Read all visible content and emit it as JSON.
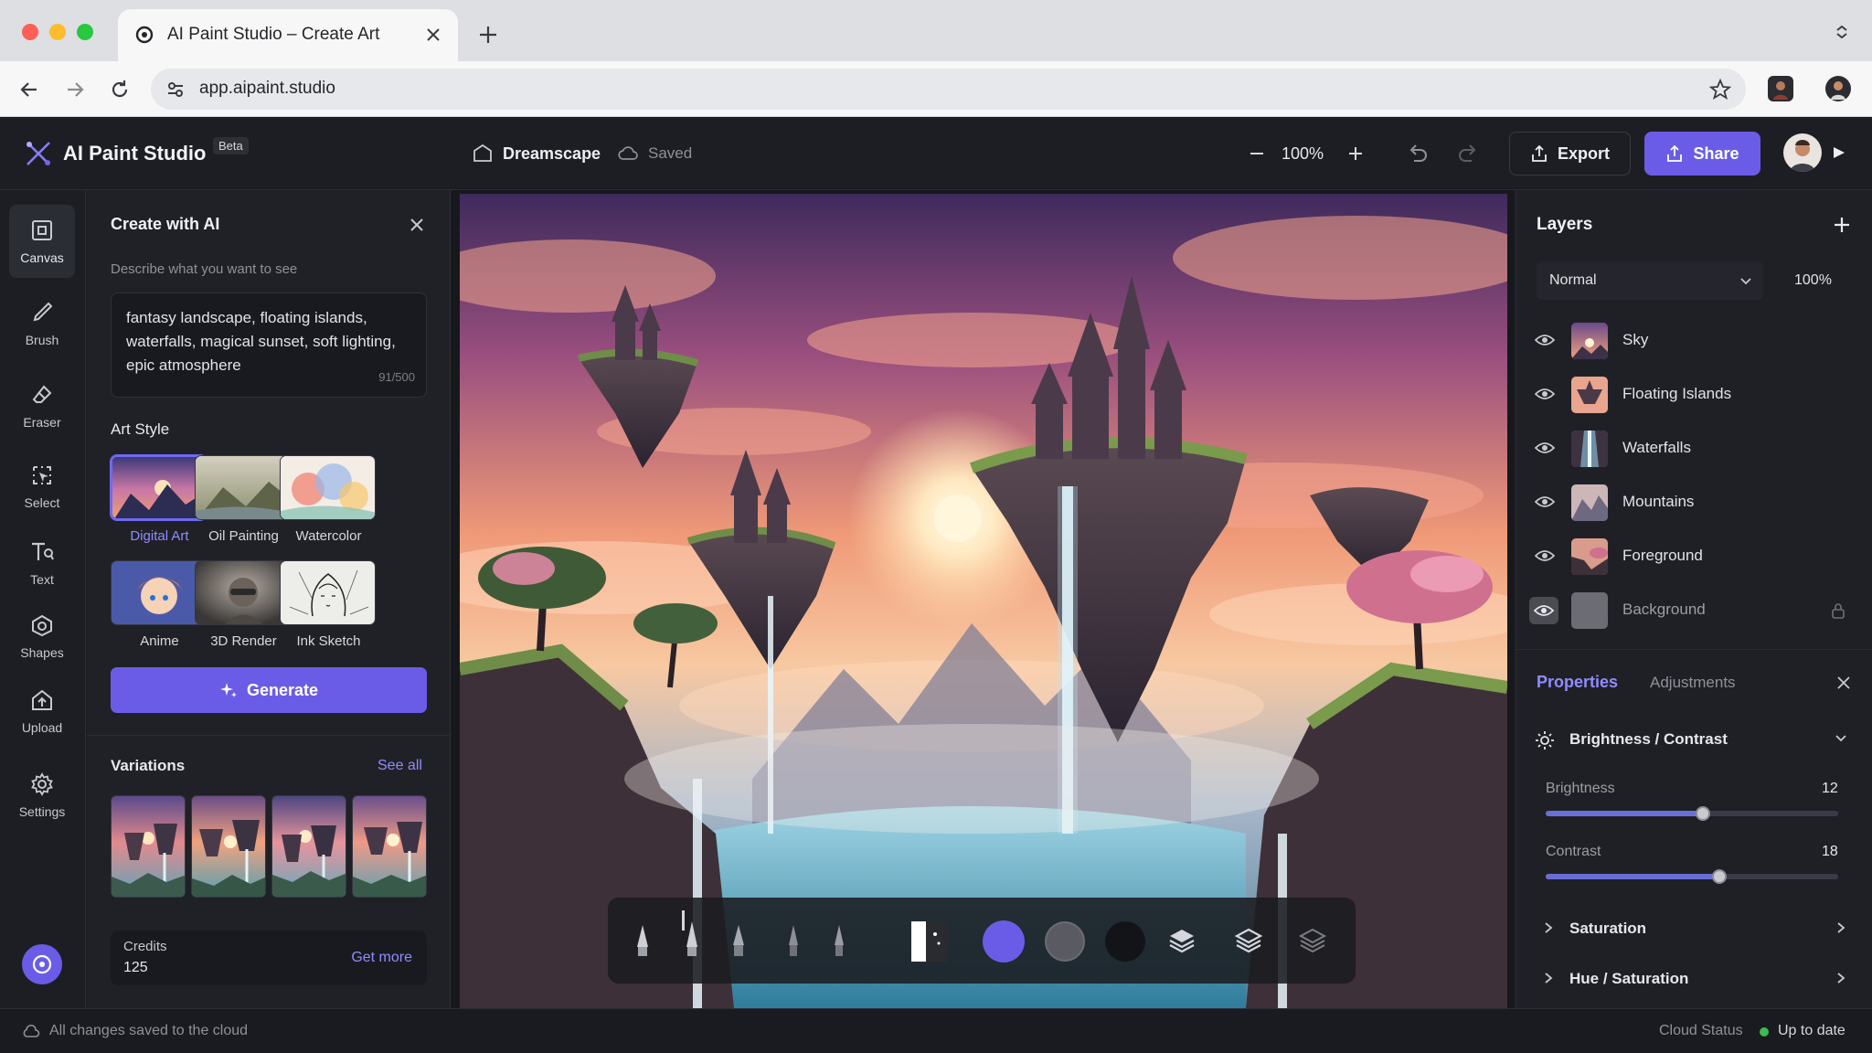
{
  "browser": {
    "tab_title": "AI Paint Studio – Create Art",
    "url": "app.aipaint.studio"
  },
  "app": {
    "name": "AI Paint Studio",
    "badge": "Beta",
    "project_name": "Dreamscape",
    "save_state": "Saved",
    "zoom": "100%",
    "export_label": "Export",
    "share_label": "Share",
    "accent": "#6b5ce7"
  },
  "rail": {
    "tools": [
      {
        "label": "Canvas",
        "icon": "canvas-icon"
      },
      {
        "label": "Brush",
        "icon": "brush-icon"
      },
      {
        "label": "Eraser",
        "icon": "eraser-icon"
      },
      {
        "label": "Select",
        "icon": "select-icon"
      },
      {
        "label": "Text",
        "icon": "text-icon"
      },
      {
        "label": "Shapes",
        "icon": "shapes-icon"
      },
      {
        "label": "Upload",
        "icon": "upload-icon"
      },
      {
        "label": "Settings",
        "icon": "settings-icon"
      }
    ]
  },
  "create": {
    "title": "Create with AI",
    "prompt_label": "Describe what you want to see",
    "prompt_text": "fantasy landscape, floating islands, waterfalls, magical sunset, soft lighting, epic atmosphere",
    "char_count": "91/500",
    "art_style_label": "Art Style",
    "styles": [
      {
        "label": "Digital Art",
        "selected": true
      },
      {
        "label": "Oil Painting",
        "selected": false
      },
      {
        "label": "Watercolor",
        "selected": false
      },
      {
        "label": "Anime",
        "selected": false
      },
      {
        "label": "3D Render",
        "selected": false
      },
      {
        "label": "Ink Sketch",
        "selected": false
      }
    ],
    "generate_label": "Generate",
    "variations_label": "Variations",
    "see_all_label": "See all",
    "credits_label": "Credits",
    "credits_value": "125",
    "get_more_label": "Get more"
  },
  "layers": {
    "title": "Layers",
    "blend_mode": "Normal",
    "opacity": "100%",
    "items": [
      {
        "name": "Sky"
      },
      {
        "name": "Floating Islands"
      },
      {
        "name": "Waterfalls"
      },
      {
        "name": "Mountains"
      },
      {
        "name": "Foreground"
      },
      {
        "name": "Background",
        "locked": true
      }
    ]
  },
  "properties": {
    "tab_properties": "Properties",
    "tab_adjustments": "Adjustments",
    "sections": {
      "brightness_contrast": "Brightness / Contrast",
      "saturation": "Saturation",
      "hue_saturation": "Hue / Saturation"
    },
    "brightness_label": "Brightness",
    "brightness_value": "12",
    "contrast_label": "Contrast",
    "contrast_value": "18"
  },
  "status": {
    "message": "All changes saved to the cloud",
    "cloud_label": "Cloud Status",
    "cloud_value": "Up to date",
    "ok_color": "#3fb950"
  }
}
